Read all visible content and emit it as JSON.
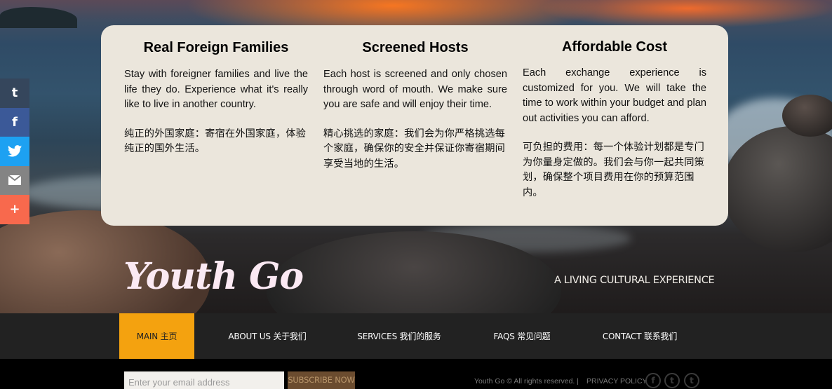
{
  "social_bar": {
    "items": [
      {
        "icon": "tumblr-icon",
        "glyph": "t"
      },
      {
        "icon": "facebook-icon",
        "glyph": "f"
      },
      {
        "icon": "twitter-icon",
        "glyph": "🐦"
      },
      {
        "icon": "email-icon",
        "glyph": "✉"
      },
      {
        "icon": "plus-icon",
        "glyph": "+"
      }
    ],
    "colors": {
      "tumblr": "#35465c",
      "facebook": "#3b5998",
      "twitter": "#1da1f2",
      "email": "#848484",
      "more": "#f8694d"
    }
  },
  "features": [
    {
      "title": "Real Foreign Families",
      "text_en": "Stay with foreigner families and live the life they do. Experience what it's really like to live in another country.",
      "text_cn": "纯正的外国家庭：寄宿在外国家庭，体验纯正的国外生活。"
    },
    {
      "title": "Screened Hosts",
      "text_en": "Each host is screened and only chosen through word of mouth. We make sure you are safe and will enjoy their time.",
      "text_cn": "精心挑选的家庭：我们会为你严格挑选每个家庭，确保你的安全并保证你寄宿期间享受当地的生活。"
    },
    {
      "title": "Affordable Cost",
      "text_en": "Each exchange experience is customized for you. We will take the time to work within your budget and plan out activities you can afford.",
      "text_cn": "可负担的费用：每一个体验计划都是专门为你量身定做的。我们会与你一起共同策划，确保整个项目费用在你的预算范围内。"
    }
  ],
  "brand": {
    "logo": "Youth Go",
    "tagline": "A LIVING CULTURAL EXPERIENCE"
  },
  "nav": {
    "items": [
      "MAIN 主页",
      "ABOUT US 关于我们",
      "SERVICES 我们的服务",
      "FAQS 常见问题",
      "CONTACT 联系我们"
    ],
    "active_index": 0,
    "accent": "#f4a20f"
  },
  "footer": {
    "email_placeholder": "Enter your email address",
    "subscribe_label": "SUBSCRIBE NOW",
    "copyright": "Youth Go ©  All rights reserved.  |",
    "privacy_label": "PRIVACY POLICY",
    "social_icons": [
      "facebook-icon",
      "twitter-icon",
      "tumblr-icon"
    ],
    "social_glyphs": [
      "f",
      "t",
      "t"
    ]
  }
}
